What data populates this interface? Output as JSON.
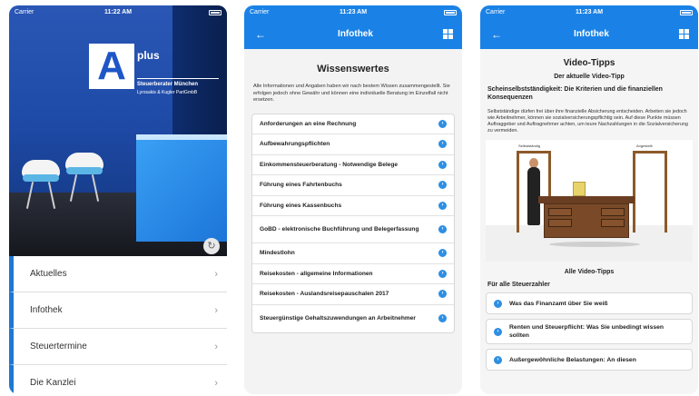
{
  "screen1": {
    "status": {
      "carrier": "Carrier",
      "time": "11:22 AM"
    },
    "office_sign": {
      "logo_letter": "A",
      "logo_plus": "plus",
      "line1": "Steuerberater München",
      "line2": "Lyrosakis & Kugler PartGmbB"
    },
    "menu_items": [
      {
        "label": "Aktuelles",
        "chevron": "›"
      },
      {
        "label": "Infothek",
        "chevron": "›"
      },
      {
        "label": "Steuertermine",
        "chevron": "›"
      },
      {
        "label": "Die Kanzlei",
        "chevron": "›"
      }
    ],
    "refresh_glyph": "↻",
    "accent_color": "#1e78d2"
  },
  "screen2": {
    "status": {
      "carrier": "Carrier",
      "time": "11:23 AM"
    },
    "nav": {
      "back_glyph": "←",
      "title": "Infothek",
      "menu_icon": "grid-icon"
    },
    "heading": "Wissenswertes",
    "intro": "Alle Informationen und Angaben haben wir nach bestem Wissen zusammengestellt. Sie erfolgen jedoch ohne Gewähr und können eine individuelle Beratung im Einzelfall nicht ersetzen.",
    "items": [
      "Anforderungen an eine Rechnung",
      "Aufbewahrungspflichten",
      "Einkommensteuerberatung - Notwendige Belege",
      "Führung eines Fahrtenbuchs",
      "Führung eines Kassenbuchs",
      "GoBD - elektronische Buchführung und Belegerfassung",
      "Mindestlohn",
      "Reisekosten - allgemeine Informationen",
      "Reisekosten - Auslandsreisepauschalen 2017",
      "Steuergünstige Gehaltszuwendungen an Arbeitnehmer"
    ],
    "arrow_glyph": "›",
    "header_color": "#1a82e6"
  },
  "screen3": {
    "status": {
      "carrier": "Carrier",
      "time": "11:23 AM"
    },
    "nav": {
      "back_glyph": "←",
      "title": "Infothek",
      "menu_icon": "grid-icon"
    },
    "heading": "Video-Tipps",
    "subheading": "Der aktuelle Video-Tipp",
    "article_title": "Scheinselbstständigkeit: Die Kriterien und die finanziellen Konsequenzen",
    "article_text": "Selbstständige dürfen frei über ihre finanzielle Absicherung entscheiden. Arbeiten sie jedoch wie Arbeitnehmer, können sie sozialversicherungspflichtig sein. Auf diese Punkte müssen Auftraggeber und Auftragnehmer achten, um teure Nachzahlungen in die Sozialversicherung zu vermeiden.",
    "video_labels": {
      "left_door": "Selbstständig",
      "right_door": "Angestellt"
    },
    "all_videos_heading": "Alle Video-Tipps",
    "group_heading": "Für alle Steuerzahler",
    "videos": [
      "Was das Finanzamt über Sie weiß",
      "Renten und Steuerpflicht: Was Sie unbedingt wissen sollten",
      "Außergewöhnliche Belastungen: An diesen"
    ],
    "arrow_glyph": "›"
  }
}
